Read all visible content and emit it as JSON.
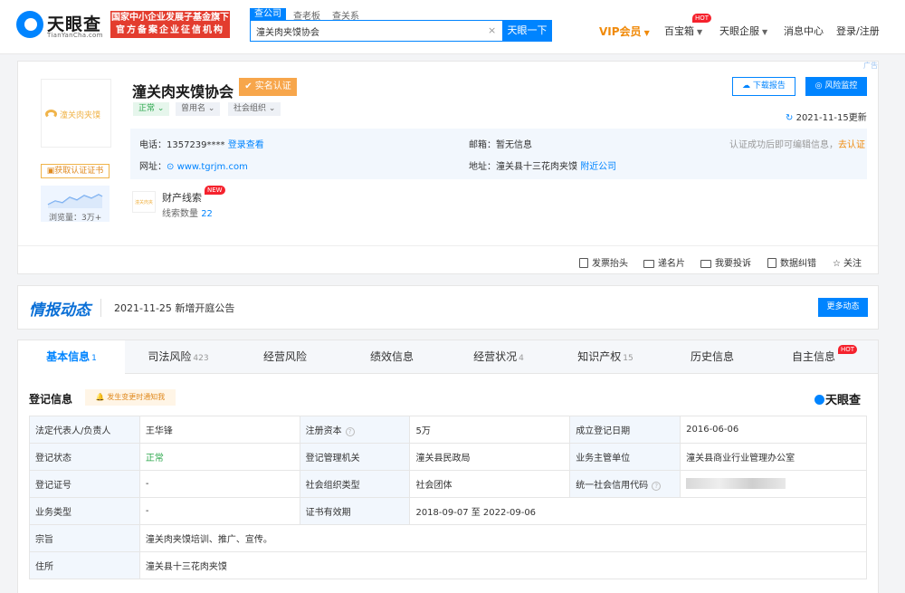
{
  "nav": {
    "logo_name": "天眼查",
    "logo_domain": "TianYanCha.com",
    "banner_line1": "国家中小企业发展子基金旗下",
    "banner_line2": "官方备案企业征信机构",
    "search_tabs": [
      "查公司",
      "查老板",
      "查关系"
    ],
    "search_value": "潼关肉夹馍协会",
    "search_clear": "×",
    "search_button": "天眼一下",
    "vip": "VIP会员",
    "treasure": "百宝箱",
    "treasure_badge": "HOT",
    "enterprise": "天眼企服",
    "messages": "消息中心",
    "login": "登录/注册"
  },
  "company": {
    "logo_text": "潼关肉夹馍",
    "name": "潼关肉夹馍协会",
    "verified": "实名认证",
    "tags": [
      "正常",
      "曾用名",
      "社会组织"
    ],
    "download_report": "下载报告",
    "risk_monitor": "风险监控",
    "updated": "2021-11-15更新",
    "ad_corner": "广告",
    "get_cert": "获取认证证书",
    "views_label": "浏览量：3万+",
    "phone_label": "电话：",
    "phone": "1357239****",
    "phone_link": "登录查看",
    "email_label": "邮箱：",
    "email": "暂无信息",
    "cert_hint": "认证成功后即可编辑信息，",
    "cert_link": "去认证",
    "site_label": "网址：",
    "site": "www.tgrjm.com",
    "address_label": "地址：",
    "address": "潼关县十三花肉夹馍",
    "nearby": "附近公司",
    "clue_title": "财产线索",
    "clue_badge": "NEW",
    "clue_count_label": "线索数量",
    "clue_count": "22",
    "actions": [
      "发票抬头",
      "递名片",
      "我要投诉",
      "数据纠错",
      "关注"
    ]
  },
  "news": {
    "title": "情报动态",
    "date": "2021-11-25",
    "text": "新增开庭公告",
    "more": "更多动态"
  },
  "tabs": [
    {
      "label": "基本信息",
      "count": "1"
    },
    {
      "label": "司法风险",
      "count": "423"
    },
    {
      "label": "经营风险",
      "count": ""
    },
    {
      "label": "绩效信息",
      "count": ""
    },
    {
      "label": "经营状况",
      "count": "4"
    },
    {
      "label": "知识产权",
      "count": "15"
    },
    {
      "label": "历史信息",
      "count": ""
    },
    {
      "label": "自主信息",
      "count": ""
    }
  ],
  "tab_hot": "HOT",
  "registration": {
    "title": "登记信息",
    "notify": "发生变更时通知我",
    "brand": "天眼查",
    "rows": [
      [
        {
          "label": "法定代表人/负责人",
          "value": "王华锋"
        },
        {
          "label": "注册资本",
          "value": "5万"
        },
        {
          "label": "成立登记日期",
          "value": "2016-06-06"
        }
      ],
      [
        {
          "label": "登记状态",
          "value": "正常"
        },
        {
          "label": "登记管理机关",
          "value": "潼关县民政局"
        },
        {
          "label": "业务主管单位",
          "value": "潼关县商业行业管理办公室"
        }
      ],
      [
        {
          "label": "登记证号",
          "value": "-"
        },
        {
          "label": "社会组织类型",
          "value": "社会团体"
        },
        {
          "label": "统一社会信用代码",
          "value": ""
        }
      ],
      [
        {
          "label": "业务类型",
          "value": "-"
        },
        {
          "label": "证书有效期",
          "value": "2018-09-07 至 2022-09-06"
        }
      ],
      [
        {
          "label": "宗旨",
          "value": "潼关肉夹馍培训、推广、宣传。"
        }
      ],
      [
        {
          "label": "住所",
          "value": "潼关县十三花肉夹馍"
        }
      ]
    ]
  },
  "colors": {
    "primary": "#0084ff",
    "vip": "#f08a0a",
    "banner": "#e33c2e",
    "status_green": "#2ea84e"
  }
}
